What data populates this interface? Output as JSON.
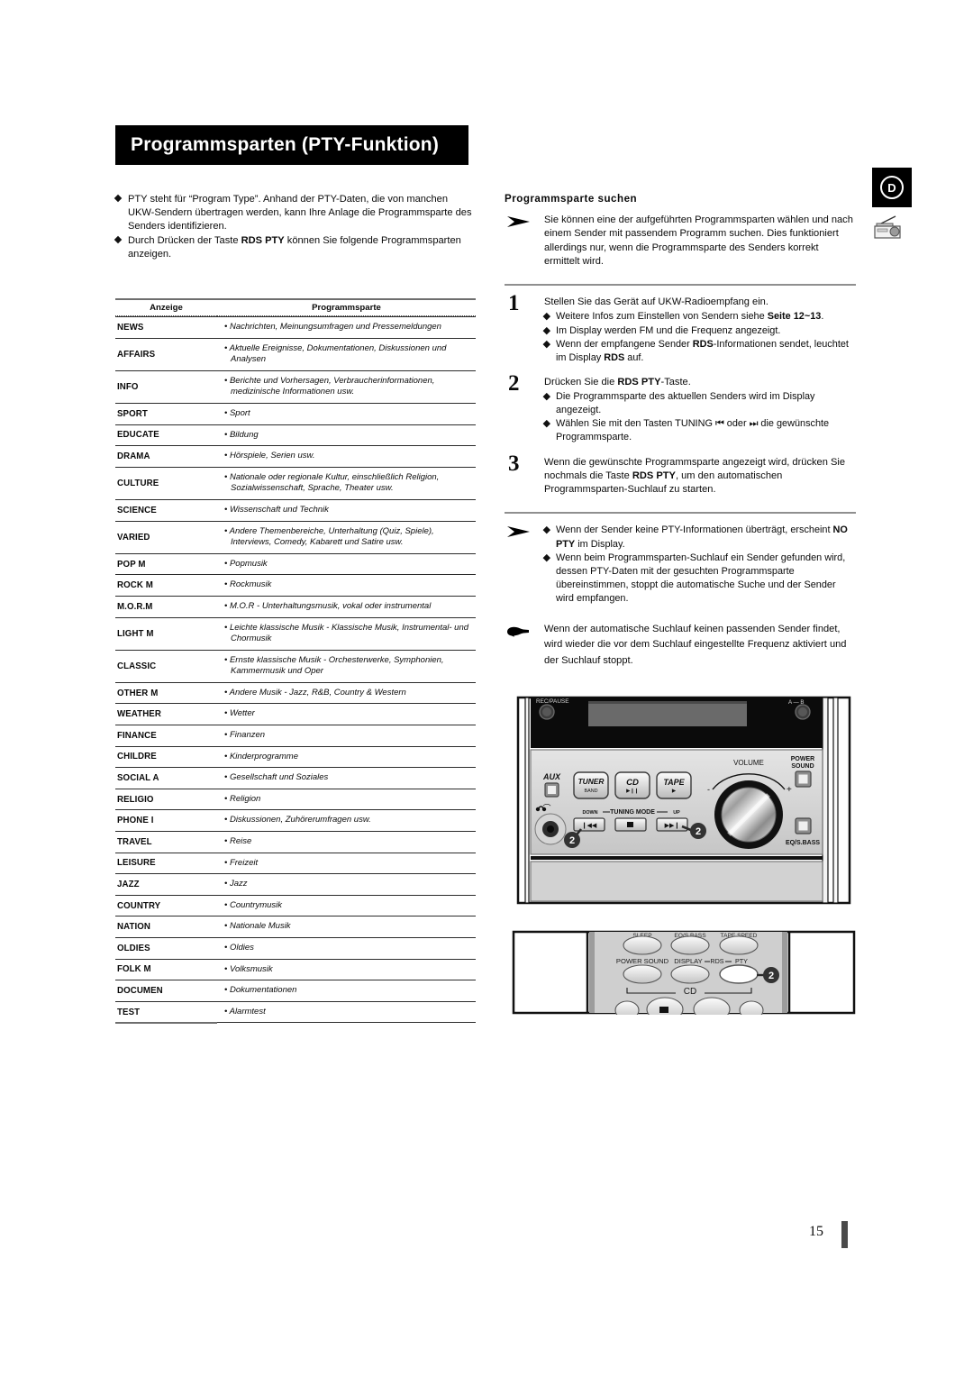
{
  "title": "Programmsparten (PTY-Funktion)",
  "corner_tab": {
    "letter": "D",
    "icon": "radio-tuner-icon"
  },
  "intro_bullets": [
    "PTY steht für “Program Type”. Anhand der PTY-Daten, die von manchen UKW-Sendern übertragen werden, kann Ihre Anlage die Programmsparte des Senders identifizieren.",
    "Durch Drücken der Taste RDS PTY können Sie folgende Programmsparten anzeigen."
  ],
  "table": {
    "header": {
      "col_a": "Anzeige",
      "col_b": "Programmsparte"
    },
    "rows": [
      {
        "code": "NEWS",
        "desc": "• Nachrichten, Meinungsumfragen und Pressemeldungen"
      },
      {
        "code": "AFFAIRS",
        "desc": "• Aktuelle Ereignisse, Dokumentationen, Diskussionen und Analysen"
      },
      {
        "code": "INFO",
        "desc": "• Berichte und Vorhersagen, Verbraucherinformationen, medizinische Informationen usw."
      },
      {
        "code": "SPORT",
        "desc": "• Sport"
      },
      {
        "code": "EDUCATE",
        "desc": "• Bildung"
      },
      {
        "code": "DRAMA",
        "desc": "• Hörspiele, Serien usw."
      },
      {
        "code": "CULTURE",
        "desc": "• Nationale oder regionale Kultur, einschließlich Religion, Sozialwissenschaft, Sprache, Theater usw."
      },
      {
        "code": "SCIENCE",
        "desc": "• Wissenschaft und Technik"
      },
      {
        "code": "VARIED",
        "desc": "• Andere Themenbereiche, Unterhaltung (Quiz, Spiele), Interviews, Comedy, Kabarett und Satire usw."
      },
      {
        "code": "POP M",
        "desc": "• Popmusik"
      },
      {
        "code": "ROCK M",
        "desc": "• Rockmusik"
      },
      {
        "code": "M.O.R.M",
        "desc": "• M.O.R - Unterhaltungsmusik, vokal oder instrumental"
      },
      {
        "code": "LIGHT M",
        "desc": "• Leichte klassische Musik - Klassische Musik, Instrumental- und Chormusik"
      },
      {
        "code": "CLASSIC",
        "desc": "• Ernste klassische Musik - Orchesterwerke, Symphonien, Kammermusik und Oper"
      },
      {
        "code": "OTHER M",
        "desc": "• Andere Musik - Jazz, R&B, Country & Western"
      },
      {
        "code": "WEATHER",
        "desc": "• Wetter"
      },
      {
        "code": "FINANCE",
        "desc": "• Finanzen"
      },
      {
        "code": "CHILDRE",
        "desc": "• Kinderprogramme"
      },
      {
        "code": "SOCIAL  A",
        "desc": "• Gesellschaft und Soziales"
      },
      {
        "code": "RELIGIO",
        "desc": "• Religion"
      },
      {
        "code": "PHONE I",
        "desc": "• Diskussionen, Zuhörerumfragen usw."
      },
      {
        "code": "TRAVEL",
        "desc": "• Reise"
      },
      {
        "code": "LEISURE",
        "desc": "• Freizeit"
      },
      {
        "code": "JAZZ",
        "desc": "• Jazz"
      },
      {
        "code": "COUNTRY",
        "desc": "• Countrymusik"
      },
      {
        "code": "NATION",
        "desc": "• Nationale Musik"
      },
      {
        "code": "OLDIES",
        "desc": "• Oldies"
      },
      {
        "code": "FOLK M",
        "desc": "• Volksmusik"
      },
      {
        "code": "DOCUMEN",
        "desc": "• Dokumentationen"
      },
      {
        "code": "TEST",
        "desc": "• Alarmtest"
      }
    ]
  },
  "right": {
    "heading": "Programmsparte suchen",
    "intro_note": "Sie können eine der aufgeführten Programmsparten wählen und nach einem Sender mit passendem Programm suchen. Dies funktioniert allerdings nur, wenn die Programmsparte des Senders korrekt ermittelt wird.",
    "steps": [
      {
        "num": "1",
        "lead": "Stellen Sie das Gerät auf UKW-Radioempfang ein.",
        "bullets": [
          "Weitere Infos zum Einstellen von Sendern siehe Seite 12~13.",
          "Im Display werden FM und die Frequenz angezeigt.",
          "Wenn der empfangene Sender RDS-Informationen sendet, leuchtet im Display RDS auf."
        ]
      },
      {
        "num": "2",
        "lead": "Drücken Sie die RDS PTY-Taste.",
        "bullets": [
          "Die Programmsparte des aktuellen Senders wird im Display angezeigt.",
          "Wählen Sie mit den Tasten TUNING ⏮ oder ⏭ die gewünschte Programmsparte."
        ]
      },
      {
        "num": "3",
        "lead": "Wenn die gewünschte Programmsparte angezeigt wird, drücken Sie nochmals die Taste RDS PTY, um den automatischen Programmsparten-Suchlauf zu starten.",
        "bullets": []
      }
    ],
    "note_bullets": [
      "Wenn der Sender keine PTY-Informationen überträgt, erscheint NO PTY im Display.",
      "Wenn beim Programmsparten-Suchlauf ein Sender gefunden wird, dessen PTY-Daten mit der gesuchten Programmsparte übereinstimmen, stoppt die automatische Suche und der Sender wird empfangen."
    ],
    "hand_note": "Wenn der automatische Suchlauf keinen passenden Sender findet, wird wieder die vor dem Suchlauf eingestellte Frequenz aktiviert und der Suchlauf stoppt."
  },
  "device": {
    "rec_pause": "REC/PAUSE",
    "ab_label": "A — B",
    "aux": "AUX",
    "tuner": "TUNER",
    "tuner_sub": "BAND",
    "cd": "CD",
    "tape": "TAPE",
    "volume": "VOLUME",
    "power_sound_1": "POWER",
    "power_sound_2": "SOUND",
    "minus": "-",
    "plus": "+",
    "eq_bass": "EQ/S.BASS",
    "tuning_down": "DOWN",
    "tuning_mode": "TUNING MODE",
    "tuning_up": "UP",
    "callout": "2"
  },
  "remote": {
    "sleep": "SLEEP",
    "eq_bass": "EQ/S.BASS",
    "tape_speed": "TAPE SPEED",
    "power_sound": "POWER SOUND",
    "display": "DISPLAY",
    "rds": "RDS",
    "pty": "PTY",
    "cd": "CD",
    "callout": "2"
  },
  "footer": {
    "page_number": "15"
  }
}
